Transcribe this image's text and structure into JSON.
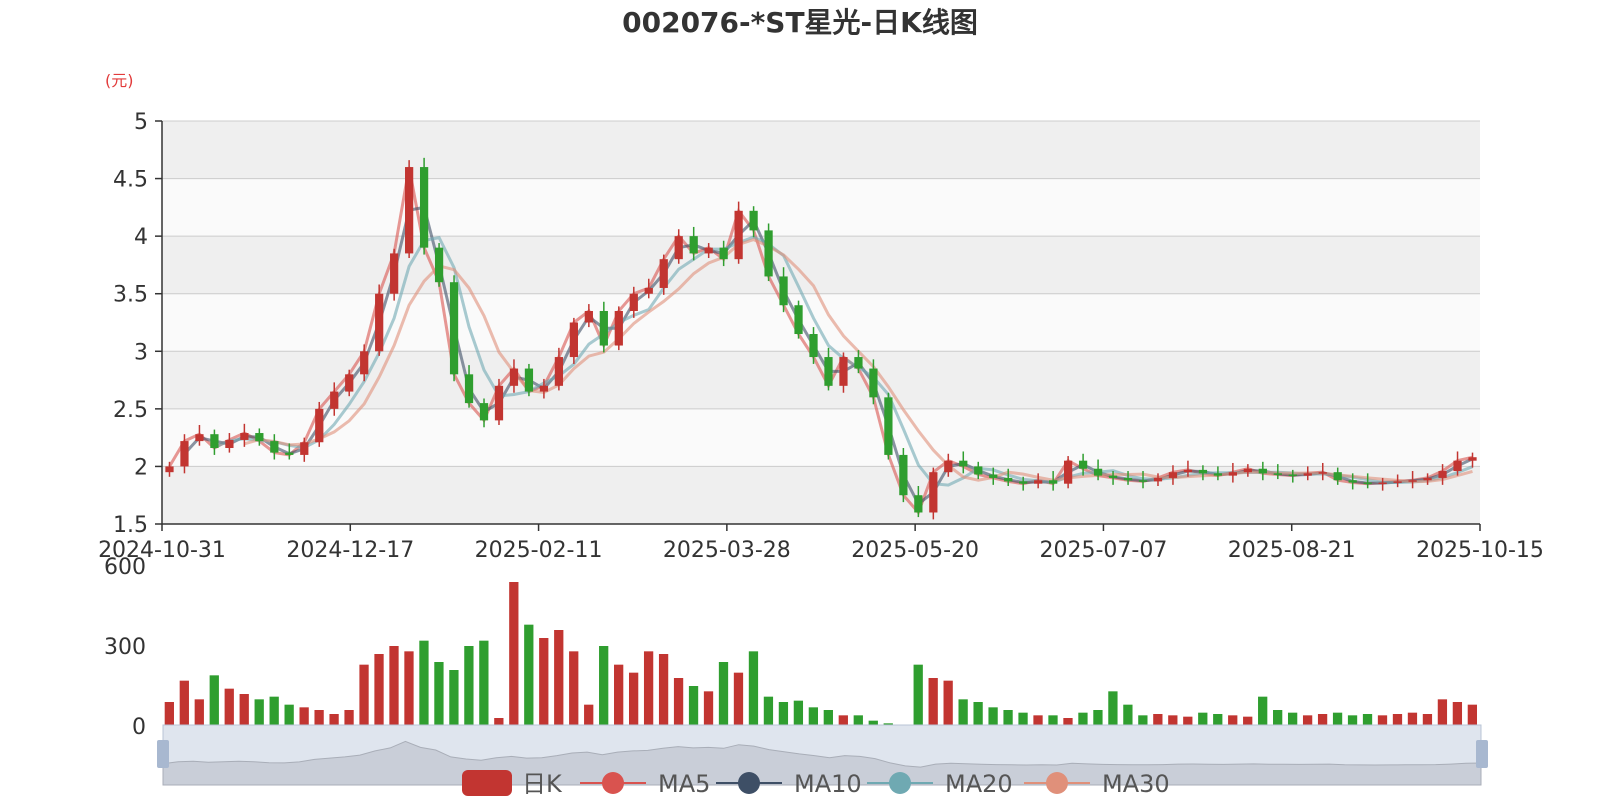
{
  "title": "002076-*ST星光-日K线图",
  "unit_label": "(元)",
  "colors": {
    "up": "#c23531",
    "down": "#2f9e2f",
    "ma5": "#d9534f",
    "ma10": "#3e4f66",
    "ma20": "#6fa9b2",
    "ma30": "#e0907a",
    "grid": "#cccccc",
    "band": "#efefef"
  },
  "legend": [
    {
      "label": "日K",
      "color": "#c23531",
      "icon": "candlestick-legend-icon"
    },
    {
      "label": "MA5",
      "color": "#d9534f",
      "icon": "line-dot-legend-icon"
    },
    {
      "label": "MA10",
      "color": "#3e4f66",
      "icon": "line-dot-legend-icon"
    },
    {
      "label": "MA20",
      "color": "#6fa9b2",
      "icon": "line-dot-legend-icon"
    },
    {
      "label": "MA30",
      "color": "#e0907a",
      "icon": "line-dot-legend-icon"
    }
  ],
  "chart_data": {
    "type": "candlestick",
    "x_tick_labels": [
      "2024-10-31",
      "2024-12-17",
      "2025-02-11",
      "2025-03-28",
      "2025-05-20",
      "2025-07-07",
      "2025-08-21",
      "2025-10-15"
    ],
    "y_ticks": [
      1.5,
      2,
      2.5,
      3,
      3.5,
      4,
      4.5,
      5
    ],
    "ylim": [
      1.5,
      5
    ],
    "volume_ticks": [
      0,
      300,
      600
    ],
    "volume_ylim": [
      0,
      600
    ],
    "grid": true,
    "legend_position": "bottom",
    "closes": [
      2.0,
      2.22,
      2.28,
      2.16,
      2.23,
      2.29,
      2.22,
      2.12,
      2.1,
      2.21,
      2.5,
      2.65,
      2.8,
      3.0,
      3.5,
      3.85,
      4.6,
      3.9,
      3.6,
      2.8,
      2.55,
      2.4,
      2.7,
      2.85,
      2.65,
      2.7,
      2.95,
      3.25,
      3.35,
      3.05,
      3.35,
      3.5,
      3.55,
      3.8,
      4.0,
      3.85,
      3.9,
      3.8,
      4.22,
      4.05,
      3.65,
      3.4,
      3.15,
      2.95,
      2.7,
      2.95,
      2.85,
      2.6,
      2.1,
      1.75,
      1.6,
      1.95,
      2.05,
      2.0,
      1.93,
      1.9,
      1.87,
      1.85,
      1.88,
      1.85,
      2.05,
      1.98,
      1.92,
      1.9,
      1.88,
      1.87,
      1.9,
      1.95,
      1.97,
      1.94,
      1.92,
      1.95,
      1.98,
      1.94,
      1.93,
      1.92,
      1.94,
      1.95,
      1.88,
      1.86,
      1.85,
      1.86,
      1.87,
      1.88,
      1.9,
      1.96,
      2.05,
      2.08
    ],
    "volumes": [
      90,
      170,
      100,
      190,
      140,
      120,
      100,
      110,
      80,
      70,
      60,
      45,
      60,
      230,
      270,
      300,
      280,
      320,
      240,
      210,
      300,
      320,
      30,
      540,
      380,
      330,
      360,
      280,
      80,
      300,
      230,
      200,
      280,
      270,
      180,
      150,
      130,
      240,
      200,
      280,
      110,
      90,
      95,
      70,
      60,
      40,
      40,
      20,
      10,
      5,
      230,
      180,
      170,
      100,
      90,
      70,
      60,
      50,
      40,
      40,
      30,
      50,
      60,
      130,
      80,
      40,
      45,
      40,
      35,
      50,
      45,
      40,
      35,
      110,
      60,
      50,
      40,
      45,
      50,
      40,
      45,
      40,
      45,
      50,
      45,
      100,
      90,
      80
    ]
  }
}
